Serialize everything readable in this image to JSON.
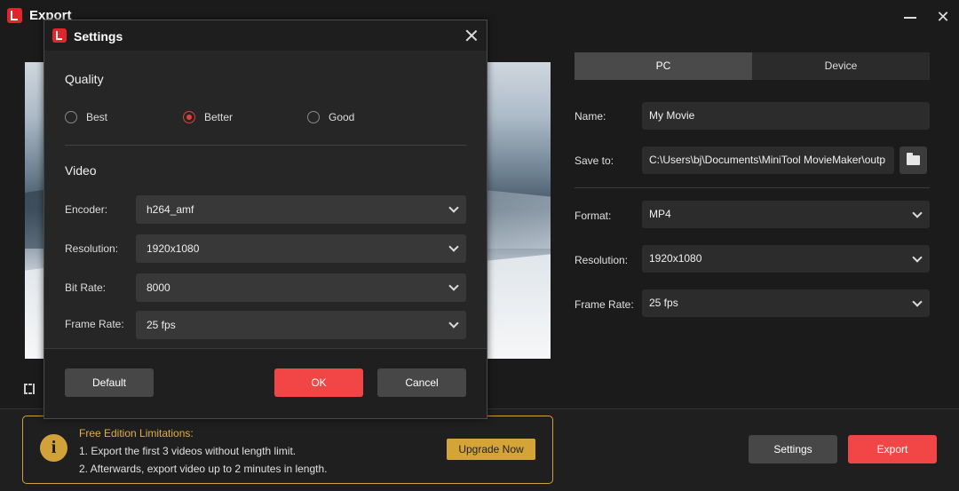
{
  "window": {
    "title": "Export"
  },
  "export_panel": {
    "tabs": [
      "PC",
      "Device"
    ],
    "name_label": "Name:",
    "name_value": "My Movie",
    "save_label": "Save to:",
    "save_value": "C:\\Users\\bj\\Documents\\MiniTool MovieMaker\\outp",
    "format_label": "Format:",
    "format_value": "MP4",
    "resolution_label": "Resolution:",
    "resolution_value": "1920x1080",
    "framerate_label": "Frame Rate:",
    "framerate_value": "25 fps"
  },
  "limitations": {
    "title": "Free Edition Limitations:",
    "line1": "1. Export the first 3 videos without length limit.",
    "line2": "2. Afterwards, export video up to 2 minutes in length.",
    "upgrade_label": "Upgrade Now"
  },
  "bottom_buttons": {
    "settings": "Settings",
    "export": "Export"
  },
  "settings_dialog": {
    "title": "Settings",
    "quality_heading": "Quality",
    "quality_options": [
      "Best",
      "Better",
      "Good"
    ],
    "quality_selected": "Better",
    "video_heading": "Video",
    "encoder_label": "Encoder:",
    "encoder_value": "h264_amf",
    "resolution_label": "Resolution:",
    "resolution_value": "1920x1080",
    "bitrate_label": "Bit Rate:",
    "bitrate_value": "8000",
    "framerate_label": "Frame Rate:",
    "framerate_value": "25 fps",
    "default_label": "Default",
    "ok_label": "OK",
    "cancel_label": "Cancel"
  },
  "colors": {
    "accent": "#f24646",
    "warning": "#d5a437"
  }
}
